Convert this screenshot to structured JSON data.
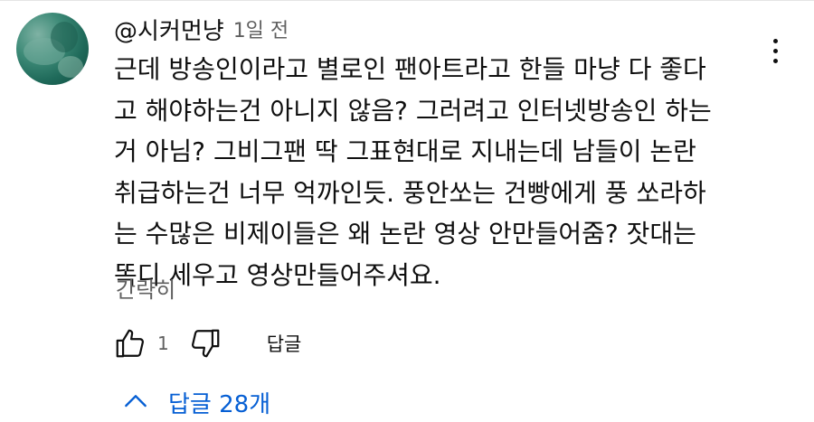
{
  "comment": {
    "author": "@시커먼냥",
    "timestamp": "1일 전",
    "lines": [
      "근데 방송인이라고 별로인 팬아트라고 한들 마냥 다 좋다",
      "고 해야하는건 아니지 않음? 그러려고 인터넷방송인 하는",
      "거 아님? 그비그팬 딱 그표현대로 지내는데 남들이 논란",
      "취급하는건 너무 억까인듯. 풍안쏘는 건빵에게 풍 쏘라하",
      "는 수많은 비제이들은 왜 논란 영상 안만들어줌? 잣대는",
      "똑디 세우고 영상만들어주셔요."
    ],
    "collapse_label": "간략히"
  },
  "actions": {
    "like_count": "1",
    "reply_label": "답글"
  },
  "replies": {
    "toggle_label": "답글 28개"
  },
  "icons": {
    "like": "thumbs-up-icon",
    "dislike": "thumbs-down-icon",
    "menu": "more-vert-icon",
    "chevron": "chevron-up-icon"
  },
  "colors": {
    "text": "#0f0f0f",
    "secondary": "#606060",
    "accent": "#065fd4"
  }
}
